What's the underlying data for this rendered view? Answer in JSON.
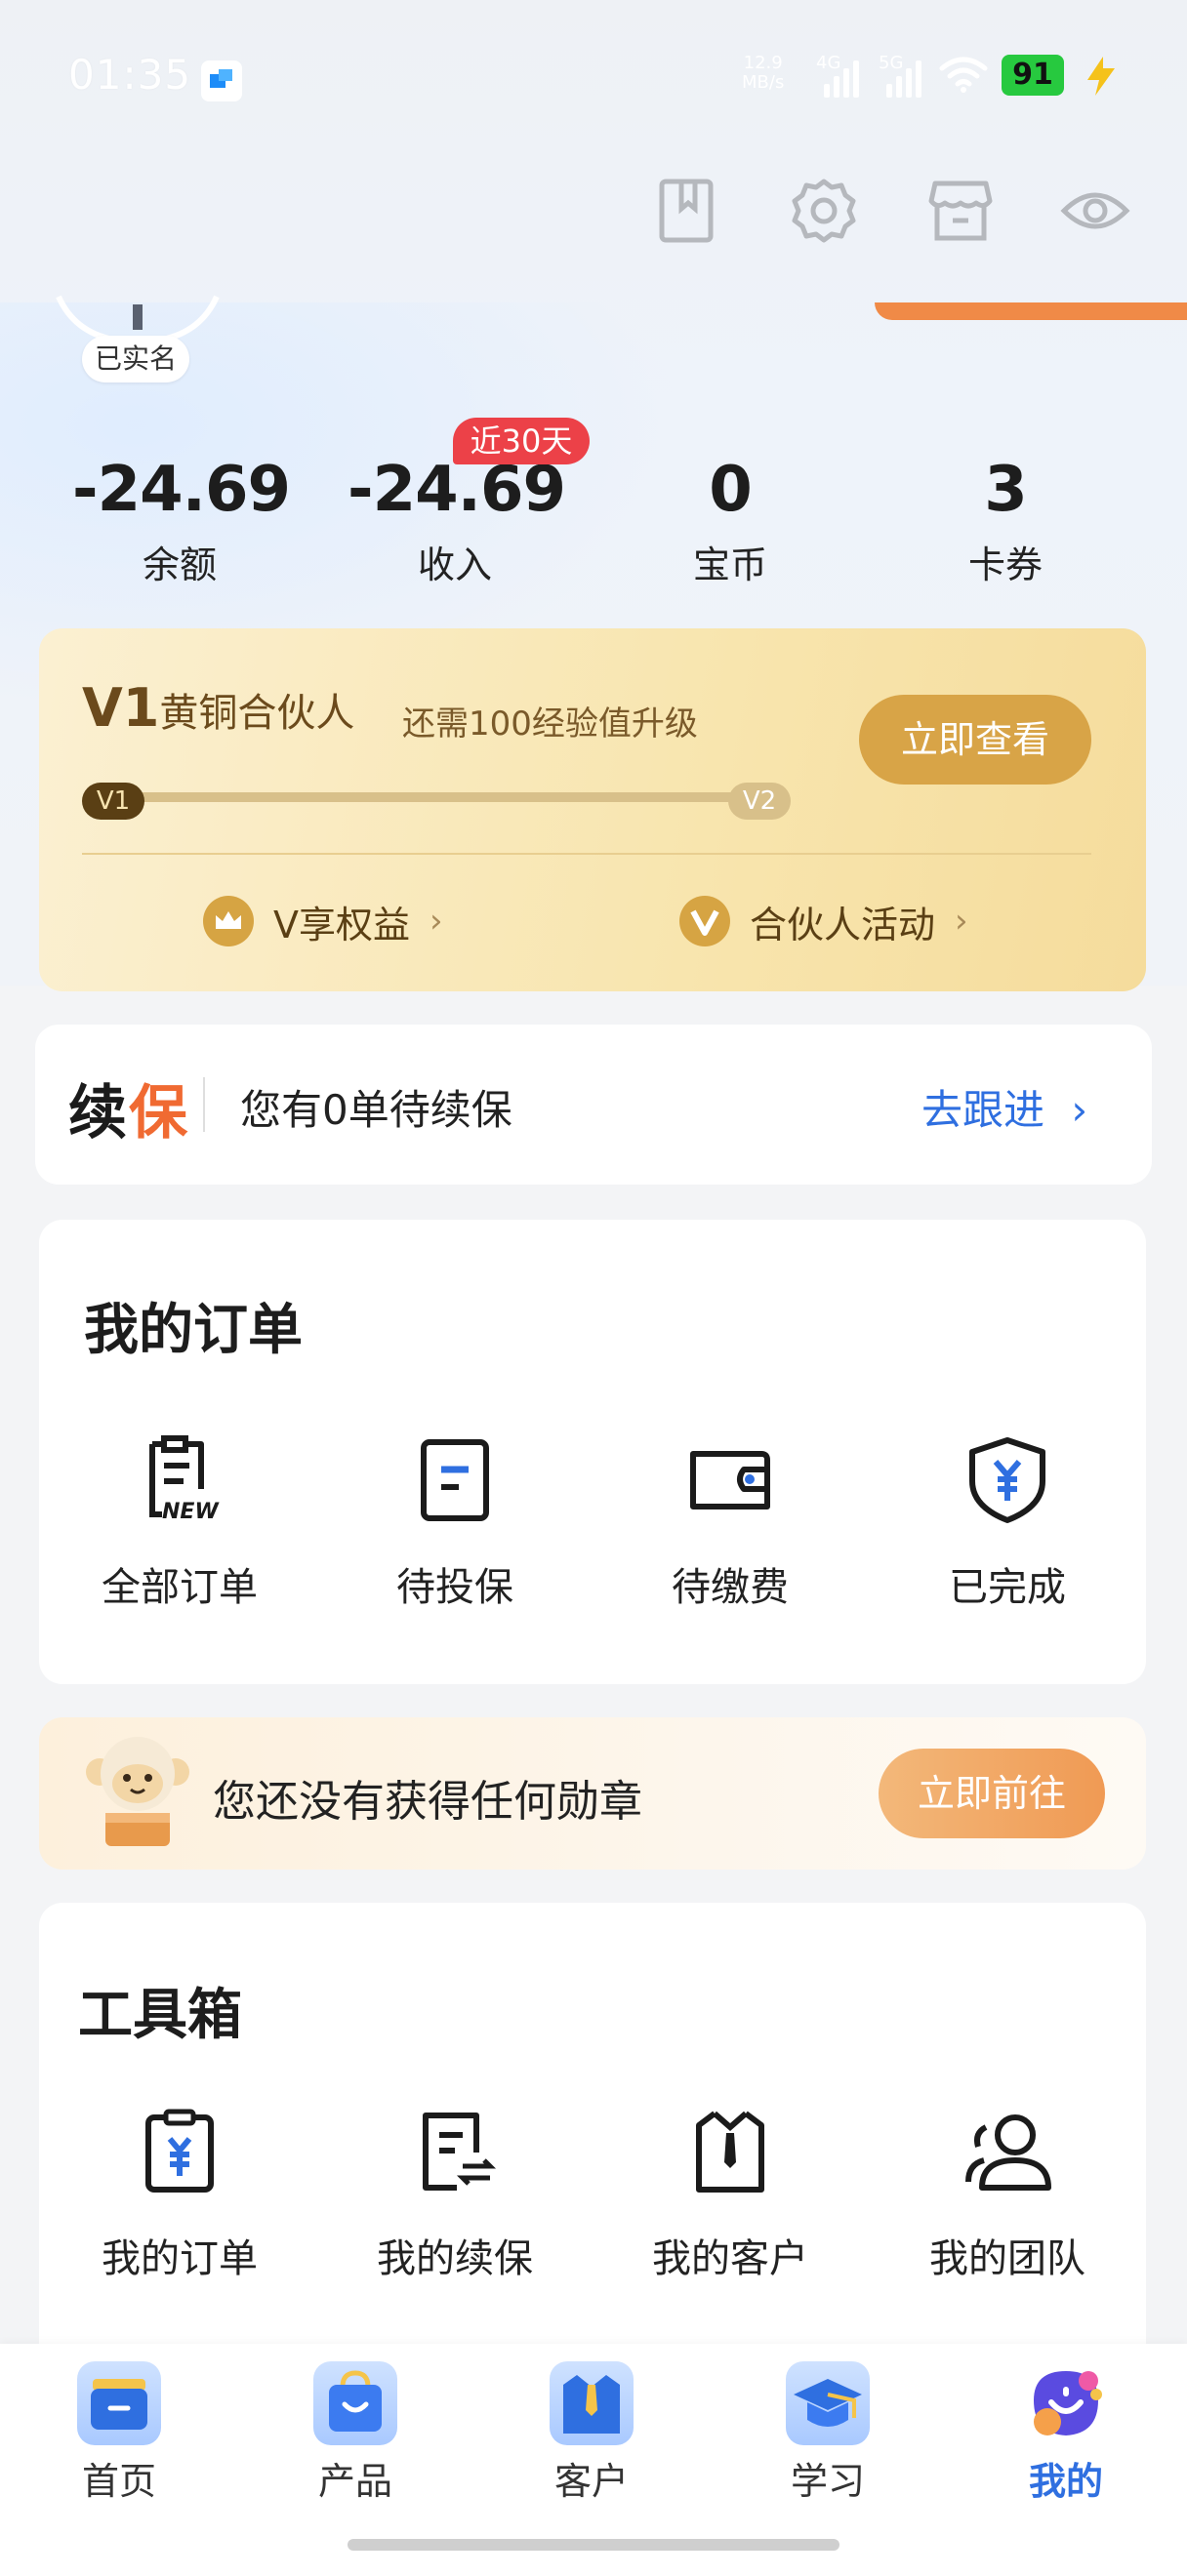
{
  "status_bar": {
    "time": "01:35",
    "net_speed_value": "12.9",
    "net_speed_unit": "MB/s",
    "net1": "4G",
    "net2": "5G",
    "battery": "91"
  },
  "header_icons": [
    "book-icon",
    "gear-icon",
    "store-icon",
    "eye-icon"
  ],
  "profile": {
    "verified_label": "已实名"
  },
  "stats": [
    {
      "value": "-24.69",
      "label": "余额"
    },
    {
      "value": "-24.69",
      "label": "收入"
    },
    {
      "value": "0",
      "label": "宝币"
    },
    {
      "value": "3",
      "label": "卡券"
    }
  ],
  "stats_tag": "近30天",
  "level": {
    "level": "V1",
    "title": "黄铜合伙人",
    "need": "还需100经验值升级",
    "view_btn": "立即查看",
    "bar_start": "V1",
    "bar_end": "V2",
    "progress": 0.0,
    "perk1": "V享权益",
    "perk2": "合伙人活动"
  },
  "renewal": {
    "logo_a": "续",
    "logo_b": "保",
    "text": "您有0单待续保",
    "action": "去跟进"
  },
  "orders": {
    "title": "我的订单",
    "items": [
      {
        "label": "全部订单",
        "icon": "new-order-icon"
      },
      {
        "label": "待投保",
        "icon": "doc-icon"
      },
      {
        "label": "待缴费",
        "icon": "wallet-icon"
      },
      {
        "label": "已完成",
        "icon": "shield-yen-icon"
      }
    ],
    "new_text": "NEW"
  },
  "badge_banner": {
    "text": "您还没有获得任何勋章",
    "button": "立即前往"
  },
  "toolbox": {
    "title": "工具箱",
    "items": [
      {
        "label": "我的订单",
        "icon": "clipboard-yen-icon"
      },
      {
        "label": "我的续保",
        "icon": "renew-doc-icon"
      },
      {
        "label": "我的客户",
        "icon": "customer-tie-icon"
      },
      {
        "label": "我的团队",
        "icon": "team-icon"
      }
    ]
  },
  "bottom_nav": [
    {
      "label": "首页",
      "active": false
    },
    {
      "label": "产品",
      "active": false
    },
    {
      "label": "客户",
      "active": false
    },
    {
      "label": "学习",
      "active": false
    },
    {
      "label": "我的",
      "active": true
    }
  ],
  "colors": {
    "accent_blue": "#2f6fe0",
    "gold": "#d8a447",
    "tag_red": "#ec4148",
    "orange": "#f06a32"
  }
}
